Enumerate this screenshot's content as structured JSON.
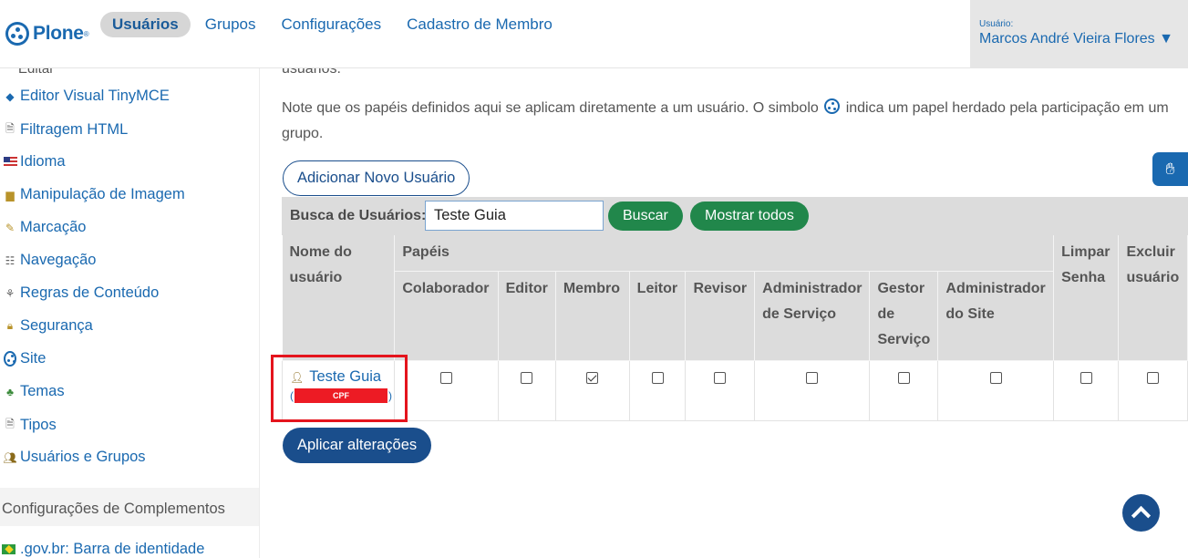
{
  "header": {
    "logo_text": "Plone",
    "logo_sup": "®",
    "nav": [
      {
        "label": "Usuários",
        "active": true
      },
      {
        "label": "Grupos"
      },
      {
        "label": "Configurações"
      },
      {
        "label": "Cadastro de Membro"
      }
    ],
    "user_label": "Usuário:",
    "user_name": "Marcos André Vieira Flores ▼"
  },
  "sidebar": {
    "cut_item": "Editar",
    "items": [
      {
        "label": "Editor Visual TinyMCE",
        "icon": "diamond-icon"
      },
      {
        "label": "Filtragem HTML",
        "icon": "document-icon"
      },
      {
        "label": "Idioma",
        "icon": "flag-us-icon"
      },
      {
        "label": "Manipulação de Imagem",
        "icon": "image-icon"
      },
      {
        "label": "Marcação",
        "icon": "pencil-icon"
      },
      {
        "label": "Navegação",
        "icon": "sitemap-icon"
      },
      {
        "label": "Regras de Conteúdo",
        "icon": "rules-icon"
      },
      {
        "label": "Segurança",
        "icon": "lock-icon"
      },
      {
        "label": "Site",
        "icon": "plone-icon"
      },
      {
        "label": "Temas",
        "icon": "theme-icon"
      },
      {
        "label": "Tipos",
        "icon": "document-icon"
      },
      {
        "label": "Usuários e Grupos",
        "icon": "users-icon"
      }
    ],
    "section_title": "Configurações de Complementos",
    "addon_item": ".gov.br: Barra de identidade"
  },
  "main": {
    "cut_text": "usuários.",
    "note_before": "Note que os papéis definidos aqui se aplicam diretamente a um usuário. O simbolo",
    "note_after": "indica um papel herdado pela participação em um grupo.",
    "add_user_label": "Adicionar Novo Usuário",
    "search_label": "Busca de Usuários:",
    "search_value": "Teste Guia",
    "search_button": "Buscar",
    "show_all_button": "Mostrar todos",
    "table": {
      "col_user": "Nome do usuário",
      "col_roles": "Papéis",
      "roles": [
        "Colaborador",
        "Editor",
        "Membro",
        "Leitor",
        "Revisor",
        "Administrador de Serviço",
        "Gestor de Serviço",
        "Administrador do Site"
      ],
      "col_reset": "Limpar Senha",
      "col_delete": "Excluir usuário",
      "rows": [
        {
          "name": "Teste Guia",
          "cpf_redacted": "CPF",
          "paren_open": "(",
          "paren_close": ")",
          "checked": [
            false,
            false,
            true,
            false,
            false,
            false,
            false,
            false
          ],
          "reset": false,
          "delete": false
        }
      ]
    },
    "apply_label": "Aplicar alterações"
  },
  "colors": {
    "brand_blue": "#1a69b0",
    "dark_blue": "#1a4e8c",
    "green": "#21874b",
    "highlight_red": "#e4141d"
  }
}
